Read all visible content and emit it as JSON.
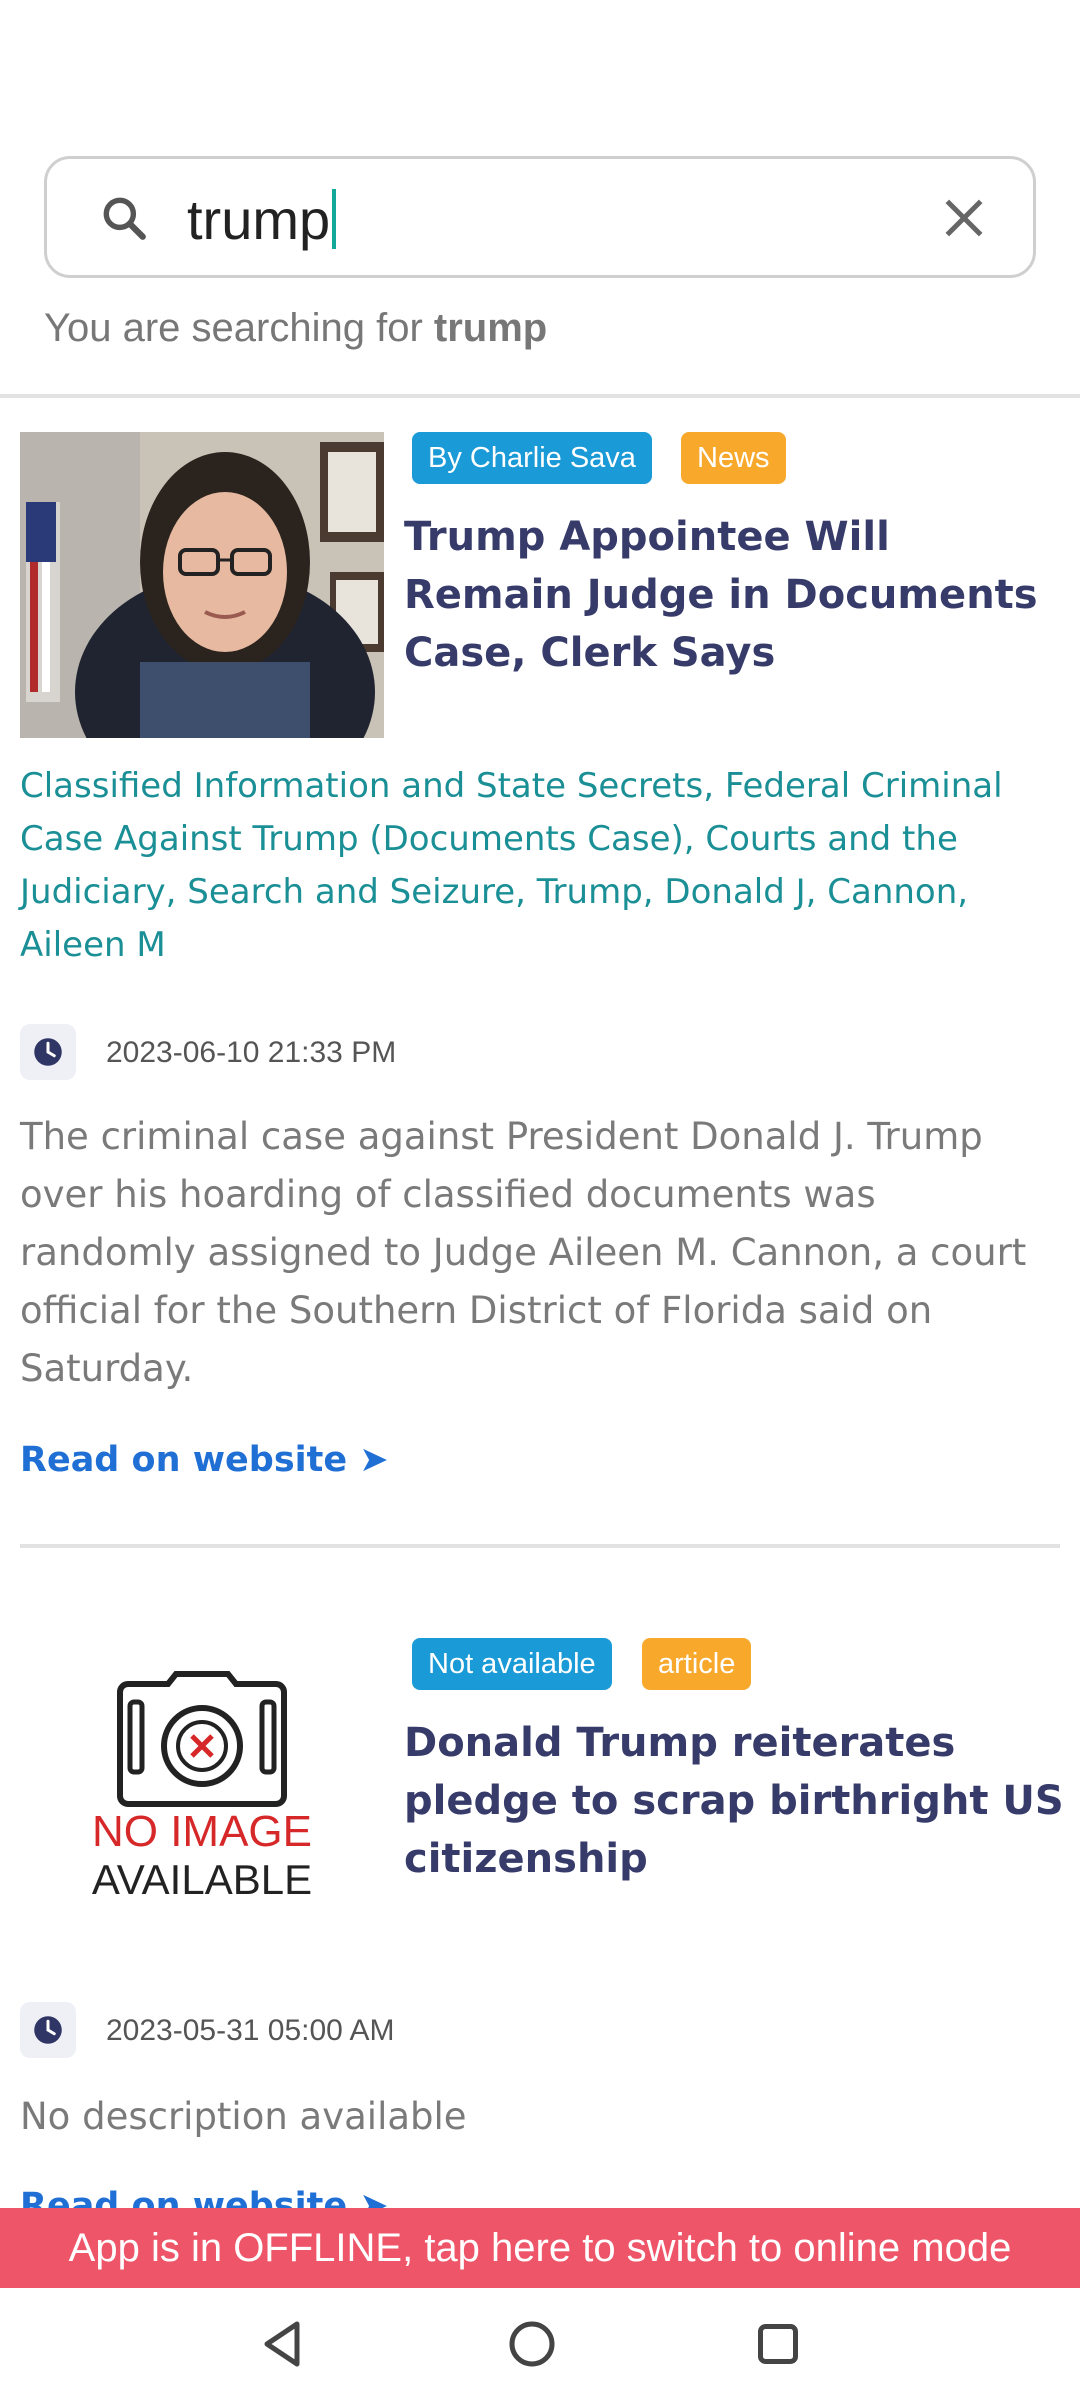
{
  "search": {
    "query": "trump",
    "searching_prefix": "You are searching for",
    "searching_term": "trump"
  },
  "articles": [
    {
      "author_badge": "By Charlie Sava",
      "type_badge": "News",
      "title": "Trump Appointee Will Remain Judge in Documents Case, Clerk Says",
      "tags": "Classified Information and State Secrets, Federal Criminal Case Against Trump (Documents Case), Courts and the Judiciary, Search and Seizure, Trump, Donald J, Cannon, Aileen M",
      "datetime": "2023-06-10 21:33 PM",
      "description": "The criminal case against President Donald J. Trump over his hoarding of classified documents was randomly assigned to Judge Aileen M. Cannon, a court official for the Southern District of Florida said on Saturday.",
      "read_link": "Read on website ➤"
    },
    {
      "author_badge": "Not available",
      "type_badge": "article",
      "title": "Donald Trump reiterates pledge to scrap birthright US citizenship",
      "no_image_line1": "NO IMAGE",
      "no_image_line2": "AVAILABLE",
      "datetime": "2023-05-31 05:00 AM",
      "description": "No description available",
      "read_link": "Read on website ➤"
    }
  ],
  "offline_banner": "App is in OFFLINE, tap here to switch to online mode",
  "colors": {
    "badge_blue": "#1a9ad6",
    "badge_orange": "#f8a92c",
    "title": "#363b6a",
    "tags": "#1a8f96",
    "link": "#1f6fd4",
    "banner": "#ef5568"
  },
  "icons": [
    "search-icon",
    "close-icon",
    "clock-icon",
    "camera-icon",
    "back-icon",
    "home-icon",
    "recents-icon"
  ]
}
